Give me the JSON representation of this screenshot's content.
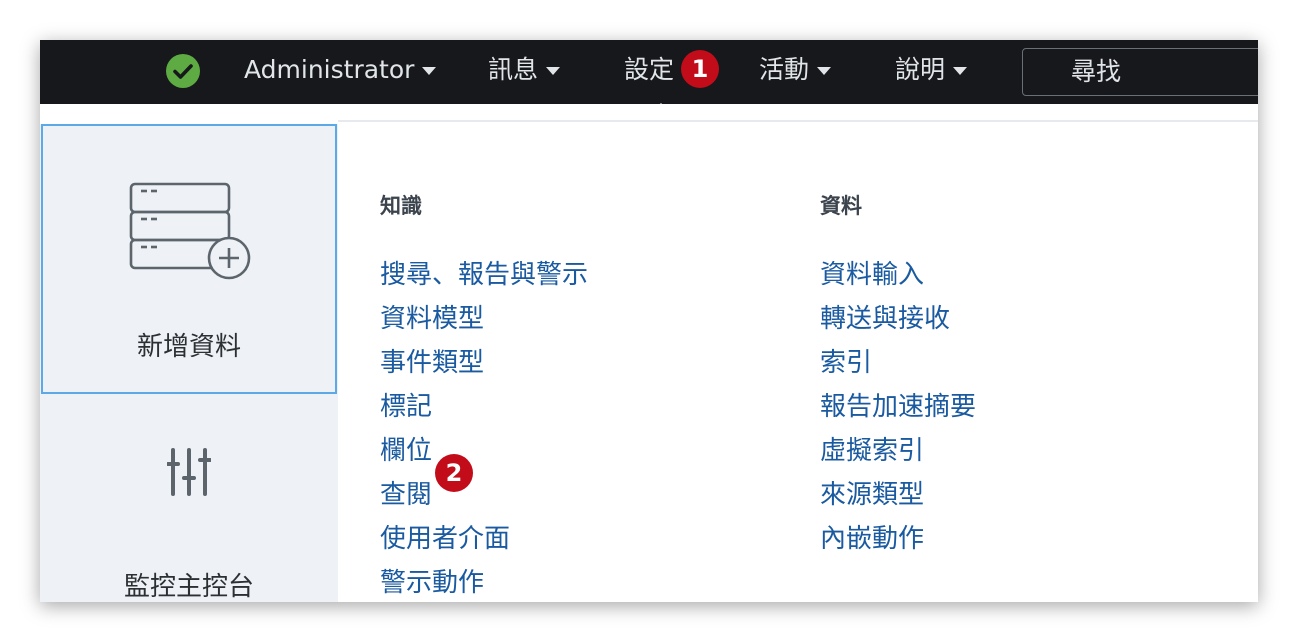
{
  "topbar": {
    "user_label": "Administrator",
    "messages_label": "訊息",
    "settings_label": "設定",
    "activity_label": "活動",
    "help_label": "說明",
    "search_placeholder": "尋找"
  },
  "badges": {
    "settings_step": "1",
    "lookups_step": "2"
  },
  "left_panel": {
    "add_data_label": "新增資料",
    "monitoring_label": "監控主控台"
  },
  "knowledge": {
    "header": "知識",
    "items": [
      "搜尋、報告與警示",
      "資料模型",
      "事件類型",
      "標記",
      "欄位",
      "查閱",
      "使用者介面",
      "警示動作"
    ]
  },
  "data_section": {
    "header": "資料",
    "items": [
      "資料輸入",
      "轉送與接收",
      "索引",
      "報告加速摘要",
      "虛擬索引",
      "來源類型",
      "內嵌動作"
    ]
  },
  "colors": {
    "topbar_bg": "#16181b",
    "link": "#1a5aa0",
    "badge": "#c20c1a",
    "status_ok": "#5dab42",
    "tile_highlight": "#5ca9e8"
  }
}
